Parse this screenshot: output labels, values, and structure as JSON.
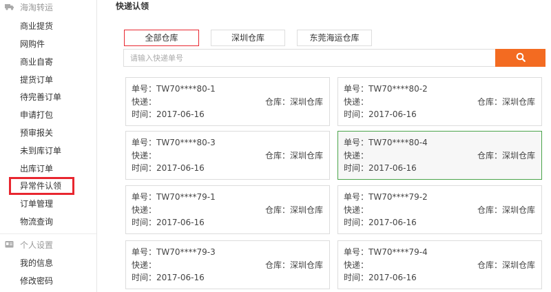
{
  "sidebar": {
    "sections": [
      {
        "title": "海淘转运",
        "icon": "truck-icon",
        "items": [
          "商业提货",
          "网购件",
          "商业自寄",
          "提货订单",
          "待完善订单",
          "申请打包",
          "预审报关",
          "未到库订单",
          "出库订单",
          "异常件认领",
          "订单管理",
          "物流查询"
        ]
      },
      {
        "title": "个人设置",
        "icon": "id-card-icon",
        "items": [
          "我的信息",
          "修改密码"
        ]
      }
    ],
    "highlighted_item": "异常件认领"
  },
  "main": {
    "title": "快递认领",
    "tabs": [
      {
        "label": "全部仓库",
        "active": true
      },
      {
        "label": "深圳仓库",
        "active": false
      },
      {
        "label": "东莞海运仓库",
        "active": false
      }
    ],
    "search": {
      "placeholder": "请输入快递单号",
      "value": "",
      "button_icon": "search-icon"
    },
    "cards": [
      {
        "number": "单号：TW70****80-1",
        "express": "快递：",
        "warehouse": "仓库：深圳仓库",
        "time": "时间：2017-06-16",
        "selected": false
      },
      {
        "number": "单号：TW70****80-2",
        "express": "快递：",
        "warehouse": "仓库：深圳仓库",
        "time": "时间：2017-06-16",
        "selected": false
      },
      {
        "number": "单号：TW70****80-3",
        "express": "快递：",
        "warehouse": "仓库：深圳仓库",
        "time": "时间：2017-06-16",
        "selected": false
      },
      {
        "number": "单号：TW70****80-4",
        "express": "快递：",
        "warehouse": "仓库：深圳仓库",
        "time": "时间：2017-06-16",
        "selected": true
      },
      {
        "number": "单号：TW70****79-1",
        "express": "快递：",
        "warehouse": "仓库：深圳仓库",
        "time": "时间：2017-06-16",
        "selected": false
      },
      {
        "number": "单号：TW70****79-2",
        "express": "快递：",
        "warehouse": "仓库：深圳仓库",
        "time": "时间：2017-06-16",
        "selected": false
      },
      {
        "number": "单号：TW70****79-3",
        "express": "快递：",
        "warehouse": "仓库：深圳仓库",
        "time": "时间：2017-06-16",
        "selected": false
      },
      {
        "number": "单号：TW70****79-4",
        "express": "快递：",
        "warehouse": "仓库：深圳仓库",
        "time": "时间：2017-06-16",
        "selected": false
      }
    ]
  },
  "colors": {
    "accent_orange": "#f36b21",
    "highlight_red": "#e8262f",
    "selected_green": "#4aa34a",
    "border": "#dcdcdc"
  }
}
